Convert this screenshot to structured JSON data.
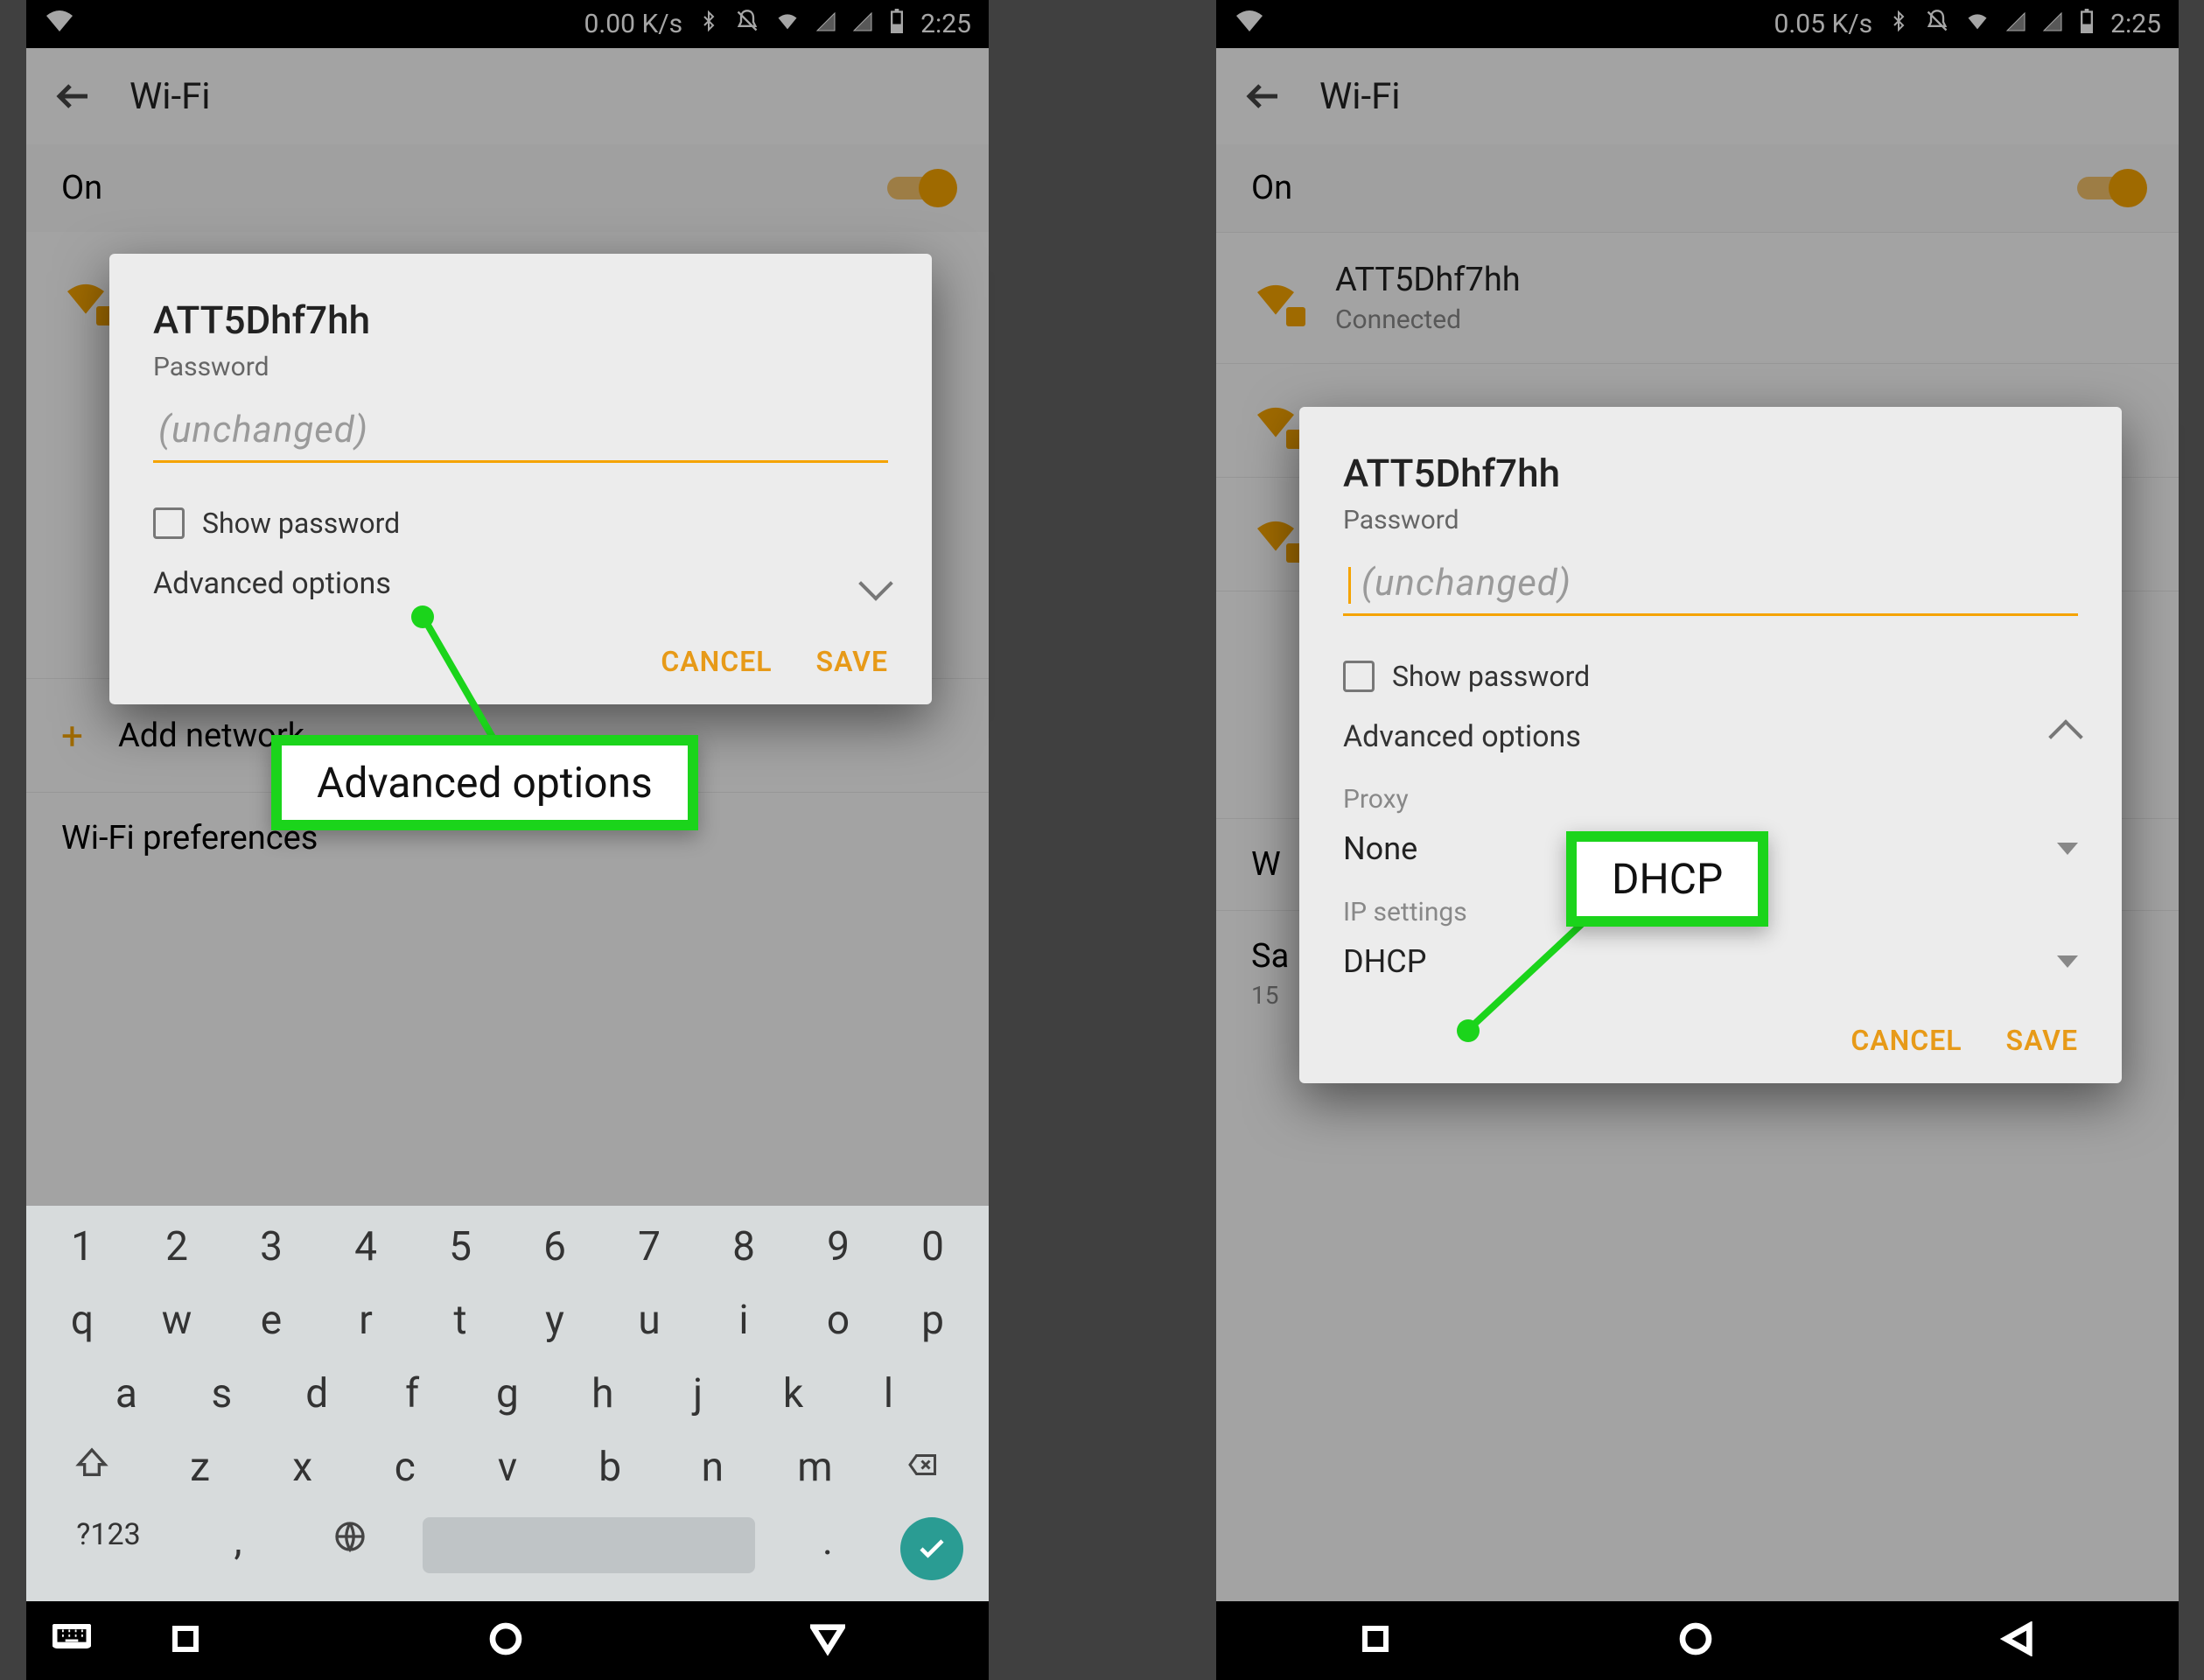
{
  "status": {
    "left_speed": "0.00 K/s",
    "right_speed": "0.05 K/s",
    "time": "2:25"
  },
  "header": {
    "title": "Wi-Fi",
    "toggle_label": "On"
  },
  "networks": {
    "ssid": "ATT5Dhf7hh",
    "connected": "Connected"
  },
  "list": {
    "add_network": "Add network",
    "prefs": "Wi-Fi preferences",
    "saved": "Saved networks",
    "w_row": "W",
    "s_row": "Sa",
    "s_sub": "15"
  },
  "dialog": {
    "ssid": "ATT5Dhf7hh",
    "password_label": "Password",
    "password_placeholder": "(unchanged)",
    "show_password": "Show password",
    "advanced": "Advanced options",
    "proxy_label": "Proxy",
    "proxy_value": "None",
    "ip_label": "IP settings",
    "ip_value": "DHCP",
    "cancel": "CANCEL",
    "save": "SAVE"
  },
  "keyboard": {
    "r1": [
      "1",
      "2",
      "3",
      "4",
      "5",
      "6",
      "7",
      "8",
      "9",
      "0"
    ],
    "r2": [
      "q",
      "w",
      "e",
      "r",
      "t",
      "y",
      "u",
      "i",
      "o",
      "p"
    ],
    "r3": [
      "a",
      "s",
      "d",
      "f",
      "g",
      "h",
      "j",
      "k",
      "l"
    ],
    "r4_mid": [
      "z",
      "x",
      "c",
      "v",
      "b",
      "n",
      "m"
    ],
    "sym": "?123",
    "comma": ",",
    "dot": "."
  },
  "callouts": {
    "advanced": "Advanced options",
    "dhcp": "DHCP"
  }
}
